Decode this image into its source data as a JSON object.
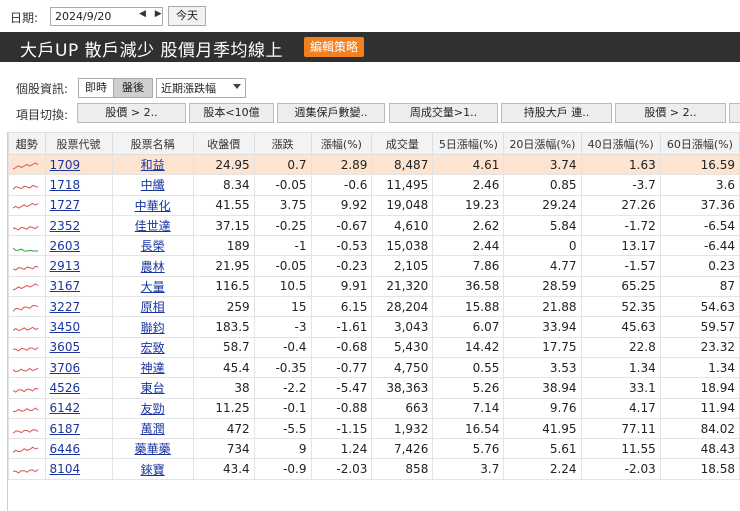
{
  "datebar": {
    "label": "日期:",
    "date_value": "2024/9/20",
    "arrows": "◀ ▶",
    "today_label": "今天"
  },
  "titlebar": {
    "title": "大戶UP 散戶減少 股價月季均線上",
    "edit_label": "編輯策略"
  },
  "info": {
    "label": "個股資訊:",
    "buttons": [
      "即時",
      "盤後"
    ],
    "active": "盤後",
    "select_value": "近期漲跌幅"
  },
  "switch": {
    "label": "項目切換:",
    "buttons": [
      "股價 > 2..",
      "股本<10億",
      "週集保戶數變..",
      "周成交量>1..",
      "持股大戶 連..",
      "股價 > 2.."
    ]
  },
  "colors": {
    "accent": "#f08020",
    "titlebar_bg": "#303030",
    "selected_row": "#fde4d0",
    "link": "#1a35a0",
    "spark_red": "#e05050",
    "spark_green": "#2fa040"
  },
  "table": {
    "headers": [
      "趨勢",
      "股票代號",
      "股票名稱",
      "收盤價",
      "漲跌",
      "漲幅(%)",
      "成交量",
      "5日漲幅(%)",
      "20日漲幅(%)",
      "40日漲幅(%)",
      "60日漲幅(%)"
    ],
    "rows": [
      {
        "trend": "up",
        "code": "1709",
        "name": "和益",
        "close": "24.95",
        "change": "0.7",
        "pct": "2.89",
        "volume": "8,487",
        "d5": "4.61",
        "d20": "3.74",
        "d40": "1.63",
        "d60": "16.59"
      },
      {
        "trend": "down",
        "code": "1718",
        "name": "中纖",
        "close": "8.34",
        "change": "-0.05",
        "pct": "-0.6",
        "volume": "11,495",
        "d5": "2.46",
        "d20": "0.85",
        "d40": "-3.7",
        "d60": "3.6"
      },
      {
        "trend": "up",
        "code": "1727",
        "name": "中華化",
        "close": "41.55",
        "change": "3.75",
        "pct": "9.92",
        "volume": "19,048",
        "d5": "19.23",
        "d20": "29.24",
        "d40": "27.26",
        "d60": "37.36"
      },
      {
        "trend": "down",
        "code": "2352",
        "name": "佳世達",
        "close": "37.15",
        "change": "-0.25",
        "pct": "-0.67",
        "volume": "4,610",
        "d5": "2.62",
        "d20": "5.84",
        "d40": "-1.72",
        "d60": "-6.54"
      },
      {
        "trend": "green",
        "code": "2603",
        "name": "長榮",
        "close": "189",
        "change": "-1",
        "pct": "-0.53",
        "volume": "15,038",
        "d5": "2.44",
        "d20": "0",
        "d40": "13.17",
        "d60": "-6.44"
      },
      {
        "trend": "down",
        "code": "2913",
        "name": "農林",
        "close": "21.95",
        "change": "-0.05",
        "pct": "-0.23",
        "volume": "2,105",
        "d5": "7.86",
        "d20": "4.77",
        "d40": "-1.57",
        "d60": "0.23"
      },
      {
        "trend": "up",
        "code": "3167",
        "name": "大量",
        "close": "116.5",
        "change": "10.5",
        "pct": "9.91",
        "volume": "21,320",
        "d5": "36.58",
        "d20": "28.59",
        "d40": "65.25",
        "d60": "87"
      },
      {
        "trend": "up",
        "code": "3227",
        "name": "原相",
        "close": "259",
        "change": "15",
        "pct": "6.15",
        "volume": "28,204",
        "d5": "15.88",
        "d20": "21.88",
        "d40": "52.35",
        "d60": "54.63"
      },
      {
        "trend": "down",
        "code": "3450",
        "name": "聯鈞",
        "close": "183.5",
        "change": "-3",
        "pct": "-1.61",
        "volume": "3,043",
        "d5": "6.07",
        "d20": "33.94",
        "d40": "45.63",
        "d60": "59.57"
      },
      {
        "trend": "down",
        "code": "3605",
        "name": "宏致",
        "close": "58.7",
        "change": "-0.4",
        "pct": "-0.68",
        "volume": "5,430",
        "d5": "14.42",
        "d20": "17.75",
        "d40": "22.8",
        "d60": "23.32"
      },
      {
        "trend": "down",
        "code": "3706",
        "name": "神達",
        "close": "45.4",
        "change": "-0.35",
        "pct": "-0.77",
        "volume": "4,750",
        "d5": "0.55",
        "d20": "3.53",
        "d40": "1.34",
        "d60": "1.34"
      },
      {
        "trend": "down",
        "code": "4526",
        "name": "東台",
        "close": "38",
        "change": "-2.2",
        "pct": "-5.47",
        "volume": "38,363",
        "d5": "5.26",
        "d20": "38.94",
        "d40": "33.1",
        "d60": "18.94"
      },
      {
        "trend": "down",
        "code": "6142",
        "name": "友勁",
        "close": "11.25",
        "change": "-0.1",
        "pct": "-0.88",
        "volume": "663",
        "d5": "7.14",
        "d20": "9.76",
        "d40": "4.17",
        "d60": "11.94"
      },
      {
        "trend": "down",
        "code": "6187",
        "name": "萬潤",
        "close": "472",
        "change": "-5.5",
        "pct": "-1.15",
        "volume": "1,932",
        "d5": "16.54",
        "d20": "41.95",
        "d40": "77.11",
        "d60": "84.02"
      },
      {
        "trend": "up",
        "code": "6446",
        "name": "藥華藥",
        "close": "734",
        "change": "9",
        "pct": "1.24",
        "volume": "7,426",
        "d5": "5.76",
        "d20": "5.61",
        "d40": "11.55",
        "d60": "48.43"
      },
      {
        "trend": "down",
        "code": "8104",
        "name": "錸寶",
        "close": "43.4",
        "change": "-0.9",
        "pct": "-2.03",
        "volume": "858",
        "d5": "3.7",
        "d20": "2.24",
        "d40": "-2.03",
        "d60": "18.58"
      }
    ]
  }
}
